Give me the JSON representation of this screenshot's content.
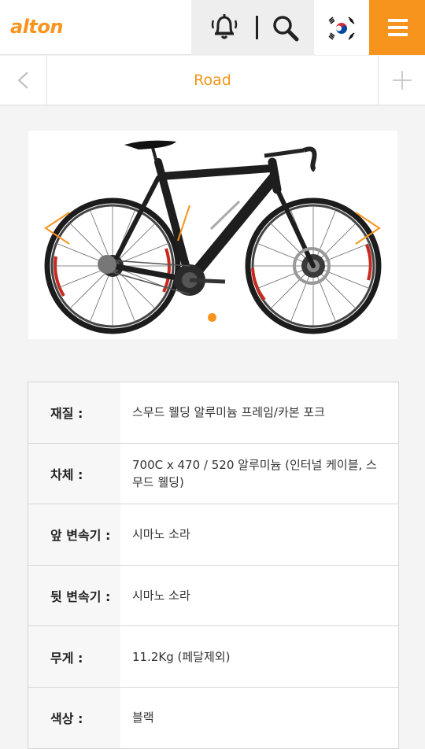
{
  "header": {
    "logo": "alton",
    "alarm_icon": "bell-icon",
    "search_icon": "search-icon",
    "flag_icon": "korea-flag-icon",
    "menu_icon": "hamburger-menu-icon"
  },
  "subnav": {
    "title": "Road",
    "back_icon": "chevron-left-icon",
    "plus_icon": "plus-icon"
  },
  "gallery": {
    "image": "road-bicycle-photo",
    "prev_icon": "chevron-left-icon",
    "next_icon": "chevron-right-icon",
    "active_slide": 1,
    "slide_count": 1
  },
  "specs": [
    {
      "label": "재질 :",
      "value": "스무드 웰딩 알루미늄 프레임/카본 포크"
    },
    {
      "label": "차체 :",
      "value": "700C x 470 / 520 알루미늄 (인터널 케이블, 스무드 웰딩)"
    },
    {
      "label": "앞 변속기 :",
      "value": "시마노 소라"
    },
    {
      "label": "뒷 변속기 :",
      "value": "시마노 소라"
    },
    {
      "label": "무게 :",
      "value": "11.2Kg (페달제외)"
    },
    {
      "label": "색상 :",
      "value": "블랙"
    }
  ],
  "colors": {
    "accent": "#f7941d",
    "frame": "#1e1e1e",
    "rim_accent": "#c8281e"
  }
}
